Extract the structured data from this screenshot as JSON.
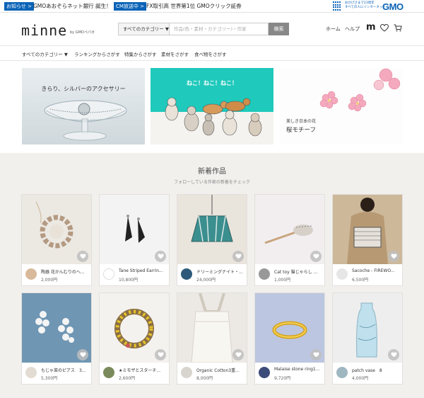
{
  "topbar": {
    "notice_tag": "お知らせ >",
    "notice_text": "GMOあおぞらネット銀行 誕生！",
    "cm_tag": "CM放送中 >",
    "cm_text": "FX取引高 世界第1位 GMOクリック証券",
    "gmo_note_1": "おかげさまで23周年",
    "gmo_note_2": "すべての人にインターネット",
    "gmo_logo": "GMO"
  },
  "header": {
    "logo": "minne",
    "logo_by": "by GMOペパボ",
    "category_select": "すべてのカテゴリー",
    "search_placeholder": "作品(色・素材・カテゴリー)・作家",
    "search_button": "検索",
    "nav_home": "ホーム",
    "nav_help": "ヘルプ",
    "m_label": "m"
  },
  "category_nav": [
    "すべてのカテゴリー ▼",
    "ランキングからさがす",
    "特集からさがす",
    "素材をさがす",
    "食べ物をさがす"
  ],
  "banners": [
    {
      "title": "きらり、シルバーのアクセサリー"
    },
    {
      "title": "ねこ！ねこ！ねこ！"
    },
    {
      "subtitle": "美しき日本の花",
      "name": "桜モチーフ"
    }
  ],
  "section": {
    "title": "新着作品",
    "subtitle": "フォローしている作家の新着をチェック"
  },
  "products": [
    {
      "title": "陶器 花かんむりのヘ...",
      "price": "2,000円"
    },
    {
      "title": "Tane Striped Earrin...",
      "price": "10,800円"
    },
    {
      "title": "ドリーミングナイト・...",
      "price": "24,000円"
    },
    {
      "title": "Cat toy 猫じゃらし ...",
      "price": "1,000円"
    },
    {
      "title": "Sacoche - FIREWO...",
      "price": "6,500円"
    },
    {
      "title": "もじゃ菜のピアス　3...",
      "price": "5,300円"
    },
    {
      "title": "★ミモザとスターチ...",
      "price": "2,600円"
    },
    {
      "title": "Organic Cotton3重...",
      "price": "8,000円"
    },
    {
      "title": "Malaise stone ring1...",
      "price": "9,720円"
    },
    {
      "title": "patch vase　8",
      "price": "4,000円"
    }
  ],
  "colors": {
    "gmo_blue": "#0a63b7",
    "banner_teal": "#1fc9bb",
    "search_button": "#888888",
    "page_background": "#f2f0ed"
  }
}
